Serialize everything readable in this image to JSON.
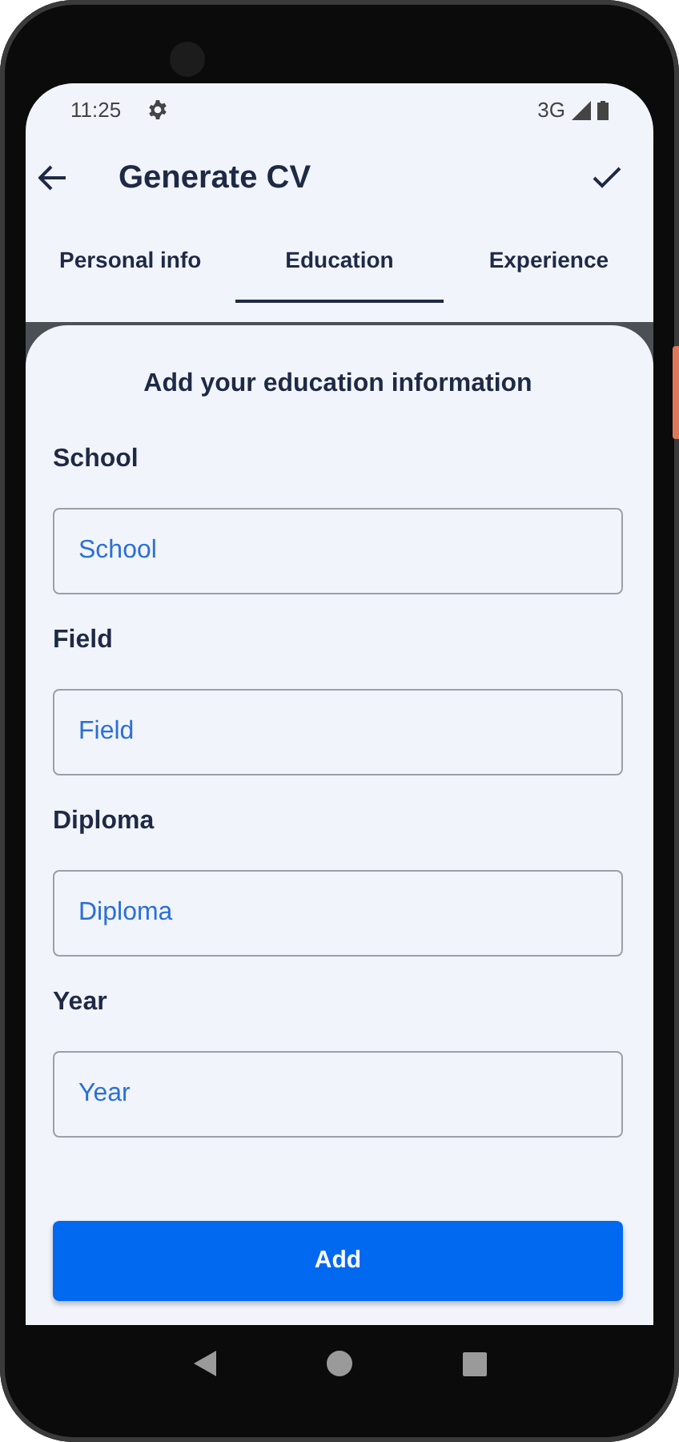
{
  "status_bar": {
    "time": "11:25",
    "network": "3G"
  },
  "app_bar": {
    "title": "Generate CV"
  },
  "tabs": [
    {
      "label": "Personal info",
      "selected": false
    },
    {
      "label": "Education",
      "selected": true
    },
    {
      "label": "Experience",
      "selected": false
    }
  ],
  "form": {
    "heading": "Add your education information",
    "fields": [
      {
        "label": "School",
        "placeholder": "School"
      },
      {
        "label": "Field",
        "placeholder": "Field"
      },
      {
        "label": "Diploma",
        "placeholder": "Diploma"
      },
      {
        "label": "Year",
        "placeholder": "Year"
      }
    ]
  },
  "button": "Add"
}
